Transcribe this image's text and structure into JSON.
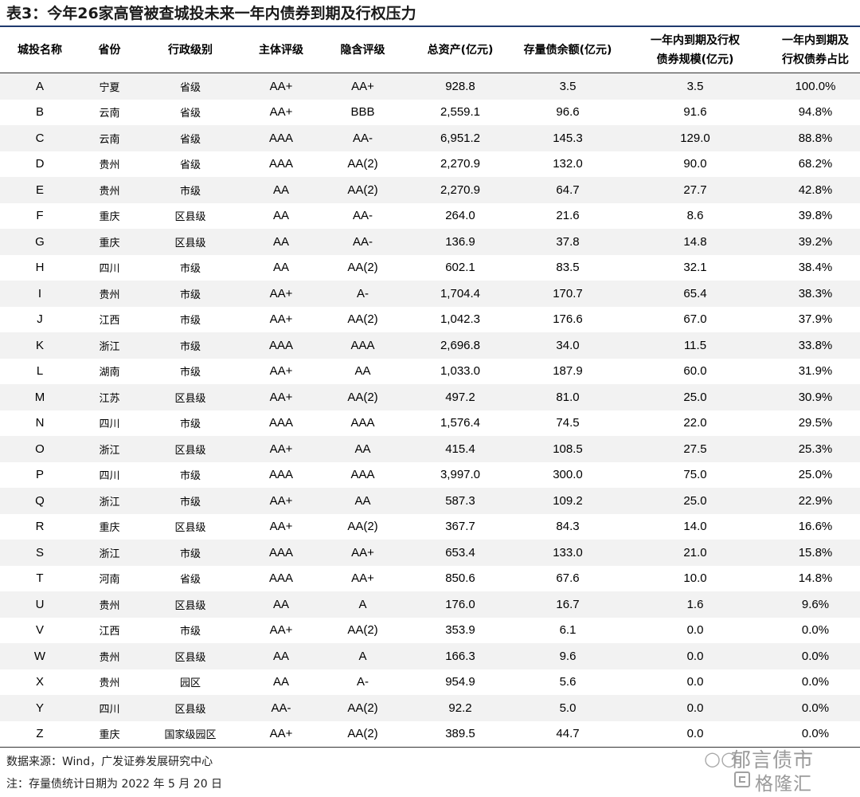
{
  "title": "表3：今年26家高管被查城投未来一年内债券到期及行权压力",
  "columns": [
    "城投名称",
    "省份",
    "行政级别",
    "主体评级",
    "隐含评级",
    "总资产(亿元)",
    "存量债余额(亿元)",
    "一年内到期及行权债券规模(亿元)",
    "一年内到期及行权债券占比"
  ],
  "header_lines": {
    "col7": [
      "一年内到期及行权",
      "债券规模(亿元)"
    ],
    "col8": [
      "一年内到期及",
      "行权债券占比"
    ]
  },
  "rows": [
    [
      "A",
      "宁夏",
      "省级",
      "AA+",
      "AA+",
      "928.8",
      "3.5",
      "3.5",
      "100.0%"
    ],
    [
      "B",
      "云南",
      "省级",
      "AA+",
      "BBB",
      "2,559.1",
      "96.6",
      "91.6",
      "94.8%"
    ],
    [
      "C",
      "云南",
      "省级",
      "AAA",
      "AA-",
      "6,951.2",
      "145.3",
      "129.0",
      "88.8%"
    ],
    [
      "D",
      "贵州",
      "省级",
      "AAA",
      "AA(2)",
      "2,270.9",
      "132.0",
      "90.0",
      "68.2%"
    ],
    [
      "E",
      "贵州",
      "市级",
      "AA",
      "AA(2)",
      "2,270.9",
      "64.7",
      "27.7",
      "42.8%"
    ],
    [
      "F",
      "重庆",
      "区县级",
      "AA",
      "AA-",
      "264.0",
      "21.6",
      "8.6",
      "39.8%"
    ],
    [
      "G",
      "重庆",
      "区县级",
      "AA",
      "AA-",
      "136.9",
      "37.8",
      "14.8",
      "39.2%"
    ],
    [
      "H",
      "四川",
      "市级",
      "AA",
      "AA(2)",
      "602.1",
      "83.5",
      "32.1",
      "38.4%"
    ],
    [
      "I",
      "贵州",
      "市级",
      "AA+",
      "A-",
      "1,704.4",
      "170.7",
      "65.4",
      "38.3%"
    ],
    [
      "J",
      "江西",
      "市级",
      "AA+",
      "AA(2)",
      "1,042.3",
      "176.6",
      "67.0",
      "37.9%"
    ],
    [
      "K",
      "浙江",
      "市级",
      "AAA",
      "AAA",
      "2,696.8",
      "34.0",
      "11.5",
      "33.8%"
    ],
    [
      "L",
      "湖南",
      "市级",
      "AA+",
      "AA",
      "1,033.0",
      "187.9",
      "60.0",
      "31.9%"
    ],
    [
      "M",
      "江苏",
      "区县级",
      "AA+",
      "AA(2)",
      "497.2",
      "81.0",
      "25.0",
      "30.9%"
    ],
    [
      "N",
      "四川",
      "市级",
      "AAA",
      "AAA",
      "1,576.4",
      "74.5",
      "22.0",
      "29.5%"
    ],
    [
      "O",
      "浙江",
      "区县级",
      "AA+",
      "AA",
      "415.4",
      "108.5",
      "27.5",
      "25.3%"
    ],
    [
      "P",
      "四川",
      "市级",
      "AAA",
      "AAA",
      "3,997.0",
      "300.0",
      "75.0",
      "25.0%"
    ],
    [
      "Q",
      "浙江",
      "市级",
      "AA+",
      "AA",
      "587.3",
      "109.2",
      "25.0",
      "22.9%"
    ],
    [
      "R",
      "重庆",
      "区县级",
      "AA+",
      "AA(2)",
      "367.7",
      "84.3",
      "14.0",
      "16.6%"
    ],
    [
      "S",
      "浙江",
      "市级",
      "AAA",
      "AA+",
      "653.4",
      "133.0",
      "21.0",
      "15.8%"
    ],
    [
      "T",
      "河南",
      "省级",
      "AAA",
      "AA+",
      "850.6",
      "67.6",
      "10.0",
      "14.8%"
    ],
    [
      "U",
      "贵州",
      "区县级",
      "AA",
      "A",
      "176.0",
      "16.7",
      "1.6",
      "9.6%"
    ],
    [
      "V",
      "江西",
      "市级",
      "AA+",
      "AA(2)",
      "353.9",
      "6.1",
      "0.0",
      "0.0%"
    ],
    [
      "W",
      "贵州",
      "区县级",
      "AA",
      "A",
      "166.3",
      "9.6",
      "0.0",
      "0.0%"
    ],
    [
      "X",
      "贵州",
      "园区",
      "AA",
      "A-",
      "954.9",
      "5.6",
      "0.0",
      "0.0%"
    ],
    [
      "Y",
      "四川",
      "区县级",
      "AA-",
      "AA(2)",
      "92.2",
      "5.0",
      "0.0",
      "0.0%"
    ],
    [
      "Z",
      "重庆",
      "国家级园区",
      "AA+",
      "AA(2)",
      "389.5",
      "44.7",
      "0.0",
      "0.0%"
    ]
  ],
  "notes": {
    "source": "数据来源：Wind，广发证券发展研究中心",
    "note": "注：存量债统计日期为 2022 年 5 月 20 日"
  },
  "watermark": {
    "line1": "郁言债市",
    "line2": "格隆汇",
    "icon": "wechat-icon",
    "logo": "gelonghui-logo-icon"
  }
}
